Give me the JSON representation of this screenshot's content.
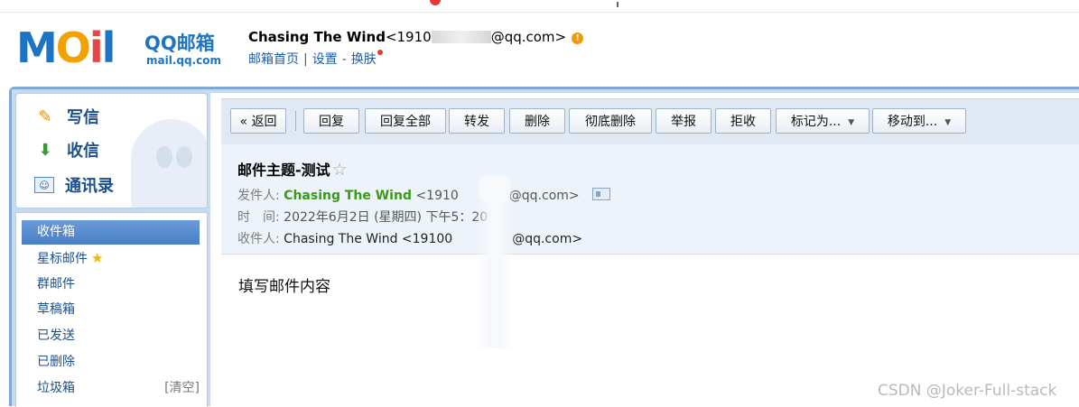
{
  "header": {
    "logo_text": "MOil",
    "brand": "QQ邮箱",
    "domain": "mail.qq.com",
    "user_name": "Chasing The Wind",
    "user_email_start": "<1910",
    "user_email_end": "@qq.com>",
    "warn_icon": "!",
    "links": [
      "邮箱首页",
      "设置",
      "换肤"
    ],
    "link_separators": [
      "|",
      "-"
    ]
  },
  "sidebar": {
    "actions": [
      {
        "label": "写信",
        "icon": "pencil-icon"
      },
      {
        "label": "收信",
        "icon": "inbox-download-icon"
      },
      {
        "label": "通讯录",
        "icon": "contact-card-icon"
      }
    ],
    "folders": [
      {
        "label": "收件箱",
        "active": true
      },
      {
        "label": "星标邮件",
        "star": "★"
      },
      {
        "label": "群邮件"
      },
      {
        "label": "草稿箱"
      },
      {
        "label": "已发送"
      },
      {
        "label": "已删除"
      },
      {
        "label": "垃圾箱",
        "extra": "[清空]"
      }
    ]
  },
  "toolbar": {
    "back": "« 返回",
    "reply": "回复",
    "reply_all": "回复全部",
    "forward": "转发",
    "delete": "删除",
    "delete_forever": "彻底删除",
    "report": "举报",
    "reject": "拒收",
    "mark_as": "标记为...",
    "move_to": "移动到...",
    "caret": "▼"
  },
  "mail": {
    "subject": "邮件主题-测试",
    "star": "☆",
    "from_label": "发件人:",
    "from_name": "Chasing The Wind",
    "from_email_start": "<1910",
    "from_email_end": "@qq.com>",
    "time_label": "时　间:",
    "time_value": "2022年6月2日 (星期四) 下午5：20",
    "to_label": "收件人:",
    "to_name": "Chasing The Wind",
    "to_email_start": "<19100",
    "to_email_end": "@qq.com>",
    "body": "填写邮件内容"
  },
  "watermark": "CSDN @Joker-Full-stack",
  "colors": {
    "brand_blue": "#1e74c4",
    "frame_blue": "#7fa8d8",
    "active_folder": "#4a7fc4",
    "sender_green": "#3b9a1a",
    "link_blue": "#1d5ca8"
  }
}
